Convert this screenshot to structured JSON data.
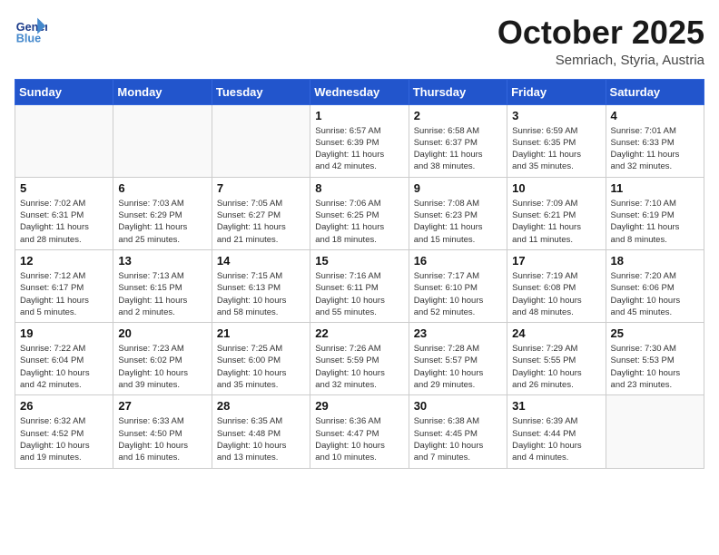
{
  "header": {
    "logo_line1": "General",
    "logo_line2": "Blue",
    "month": "October 2025",
    "location": "Semriach, Styria, Austria"
  },
  "weekdays": [
    "Sunday",
    "Monday",
    "Tuesday",
    "Wednesday",
    "Thursday",
    "Friday",
    "Saturday"
  ],
  "weeks": [
    [
      {
        "day": "",
        "info": ""
      },
      {
        "day": "",
        "info": ""
      },
      {
        "day": "",
        "info": ""
      },
      {
        "day": "1",
        "info": "Sunrise: 6:57 AM\nSunset: 6:39 PM\nDaylight: 11 hours\nand 42 minutes."
      },
      {
        "day": "2",
        "info": "Sunrise: 6:58 AM\nSunset: 6:37 PM\nDaylight: 11 hours\nand 38 minutes."
      },
      {
        "day": "3",
        "info": "Sunrise: 6:59 AM\nSunset: 6:35 PM\nDaylight: 11 hours\nand 35 minutes."
      },
      {
        "day": "4",
        "info": "Sunrise: 7:01 AM\nSunset: 6:33 PM\nDaylight: 11 hours\nand 32 minutes."
      }
    ],
    [
      {
        "day": "5",
        "info": "Sunrise: 7:02 AM\nSunset: 6:31 PM\nDaylight: 11 hours\nand 28 minutes."
      },
      {
        "day": "6",
        "info": "Sunrise: 7:03 AM\nSunset: 6:29 PM\nDaylight: 11 hours\nand 25 minutes."
      },
      {
        "day": "7",
        "info": "Sunrise: 7:05 AM\nSunset: 6:27 PM\nDaylight: 11 hours\nand 21 minutes."
      },
      {
        "day": "8",
        "info": "Sunrise: 7:06 AM\nSunset: 6:25 PM\nDaylight: 11 hours\nand 18 minutes."
      },
      {
        "day": "9",
        "info": "Sunrise: 7:08 AM\nSunset: 6:23 PM\nDaylight: 11 hours\nand 15 minutes."
      },
      {
        "day": "10",
        "info": "Sunrise: 7:09 AM\nSunset: 6:21 PM\nDaylight: 11 hours\nand 11 minutes."
      },
      {
        "day": "11",
        "info": "Sunrise: 7:10 AM\nSunset: 6:19 PM\nDaylight: 11 hours\nand 8 minutes."
      }
    ],
    [
      {
        "day": "12",
        "info": "Sunrise: 7:12 AM\nSunset: 6:17 PM\nDaylight: 11 hours\nand 5 minutes."
      },
      {
        "day": "13",
        "info": "Sunrise: 7:13 AM\nSunset: 6:15 PM\nDaylight: 11 hours\nand 2 minutes."
      },
      {
        "day": "14",
        "info": "Sunrise: 7:15 AM\nSunset: 6:13 PM\nDaylight: 10 hours\nand 58 minutes."
      },
      {
        "day": "15",
        "info": "Sunrise: 7:16 AM\nSunset: 6:11 PM\nDaylight: 10 hours\nand 55 minutes."
      },
      {
        "day": "16",
        "info": "Sunrise: 7:17 AM\nSunset: 6:10 PM\nDaylight: 10 hours\nand 52 minutes."
      },
      {
        "day": "17",
        "info": "Sunrise: 7:19 AM\nSunset: 6:08 PM\nDaylight: 10 hours\nand 48 minutes."
      },
      {
        "day": "18",
        "info": "Sunrise: 7:20 AM\nSunset: 6:06 PM\nDaylight: 10 hours\nand 45 minutes."
      }
    ],
    [
      {
        "day": "19",
        "info": "Sunrise: 7:22 AM\nSunset: 6:04 PM\nDaylight: 10 hours\nand 42 minutes."
      },
      {
        "day": "20",
        "info": "Sunrise: 7:23 AM\nSunset: 6:02 PM\nDaylight: 10 hours\nand 39 minutes."
      },
      {
        "day": "21",
        "info": "Sunrise: 7:25 AM\nSunset: 6:00 PM\nDaylight: 10 hours\nand 35 minutes."
      },
      {
        "day": "22",
        "info": "Sunrise: 7:26 AM\nSunset: 5:59 PM\nDaylight: 10 hours\nand 32 minutes."
      },
      {
        "day": "23",
        "info": "Sunrise: 7:28 AM\nSunset: 5:57 PM\nDaylight: 10 hours\nand 29 minutes."
      },
      {
        "day": "24",
        "info": "Sunrise: 7:29 AM\nSunset: 5:55 PM\nDaylight: 10 hours\nand 26 minutes."
      },
      {
        "day": "25",
        "info": "Sunrise: 7:30 AM\nSunset: 5:53 PM\nDaylight: 10 hours\nand 23 minutes."
      }
    ],
    [
      {
        "day": "26",
        "info": "Sunrise: 6:32 AM\nSunset: 4:52 PM\nDaylight: 10 hours\nand 19 minutes."
      },
      {
        "day": "27",
        "info": "Sunrise: 6:33 AM\nSunset: 4:50 PM\nDaylight: 10 hours\nand 16 minutes."
      },
      {
        "day": "28",
        "info": "Sunrise: 6:35 AM\nSunset: 4:48 PM\nDaylight: 10 hours\nand 13 minutes."
      },
      {
        "day": "29",
        "info": "Sunrise: 6:36 AM\nSunset: 4:47 PM\nDaylight: 10 hours\nand 10 minutes."
      },
      {
        "day": "30",
        "info": "Sunrise: 6:38 AM\nSunset: 4:45 PM\nDaylight: 10 hours\nand 7 minutes."
      },
      {
        "day": "31",
        "info": "Sunrise: 6:39 AM\nSunset: 4:44 PM\nDaylight: 10 hours\nand 4 minutes."
      },
      {
        "day": "",
        "info": ""
      }
    ]
  ]
}
